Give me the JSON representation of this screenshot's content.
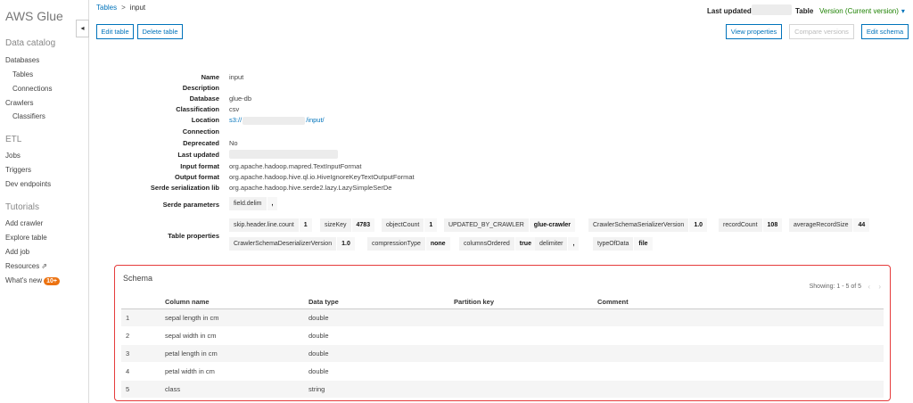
{
  "sidebar": {
    "brand": "AWS Glue",
    "data_catalog": {
      "title": "Data catalog",
      "items": [
        "Databases",
        "Tables",
        "Connections",
        "Crawlers",
        "Classifiers"
      ]
    },
    "etl": {
      "title": "ETL",
      "items": [
        "Jobs",
        "Triggers",
        "Dev endpoints"
      ]
    },
    "tutorials": {
      "title": "Tutorials",
      "items": [
        "Add crawler",
        "Explore table",
        "Add job"
      ]
    },
    "resources": "Resources",
    "whats_new": "What's new",
    "whats_new_badge": "10+",
    "collapse_glyph": "◂",
    "external_glyph": "⇗"
  },
  "breadcrumb": {
    "tables": "Tables",
    "separator": ">",
    "current": "input"
  },
  "header": {
    "last_updated_label": "Last updated",
    "table_label": "Table",
    "version": "Version (Current version)",
    "version_caret": "▾"
  },
  "actions": {
    "edit_table": "Edit table",
    "delete_table": "Delete table",
    "view_properties": "View properties",
    "compare_versions": "Compare versions",
    "edit_schema": "Edit schema"
  },
  "properties": {
    "name_label": "Name",
    "name": "input",
    "description_label": "Description",
    "database_label": "Database",
    "database": "glue-db",
    "classification_label": "Classification",
    "classification": "csv",
    "location_label": "Location",
    "location_prefix": "s3://",
    "location_suffix": "/input/",
    "connection_label": "Connection",
    "deprecated_label": "Deprecated",
    "deprecated": "No",
    "last_updated_label": "Last updated",
    "input_format_label": "Input format",
    "input_format": "org.apache.hadoop.mapred.TextInputFormat",
    "output_format_label": "Output format",
    "output_format": "org.apache.hadoop.hive.ql.io.HiveIgnoreKeyTextOutputFormat",
    "serde_lib_label": "Serde serialization lib",
    "serde_lib": "org.apache.hadoop.hive.serde2.lazy.LazySimpleSerDe",
    "serde_params_label": "Serde parameters",
    "serde_params": [
      {
        "key": "field.delim",
        "value": ","
      }
    ],
    "table_props_label": "Table properties",
    "table_props_row1": [
      {
        "key": "skip.header.line.count",
        "value": "1"
      },
      {
        "key": "sizeKey",
        "value": "4783"
      },
      {
        "key": "objectCount",
        "value": "1"
      },
      {
        "key": "UPDATED_BY_CRAWLER",
        "value": "glue-crawler"
      },
      {
        "key": "CrawlerSchemaSerializerVersion",
        "value": "1.0"
      },
      {
        "key": "recordCount",
        "value": "108"
      },
      {
        "key": "averageRecordSize",
        "value": "44"
      }
    ],
    "table_props_row2": [
      {
        "key": "CrawlerSchemaDeserializerVersion",
        "value": "1.0"
      },
      {
        "key": "compressionType",
        "value": "none"
      },
      {
        "key": "columnsOrdered",
        "value": "true"
      },
      {
        "key": "delimiter",
        "value": ","
      },
      {
        "key": "typeOfData",
        "value": "file"
      }
    ]
  },
  "schema": {
    "title": "Schema",
    "showing": "Showing: 1 - 5 of 5",
    "prev": "‹",
    "next": "›",
    "columns": [
      "Column name",
      "Data type",
      "Partition key",
      "Comment"
    ],
    "rows": [
      {
        "num": "1",
        "name": "sepal length in cm",
        "type": "double",
        "partition": "",
        "comment": ""
      },
      {
        "num": "2",
        "name": "sepal width in cm",
        "type": "double",
        "partition": "",
        "comment": ""
      },
      {
        "num": "3",
        "name": "petal length in cm",
        "type": "double",
        "partition": "",
        "comment": ""
      },
      {
        "num": "4",
        "name": "petal width in cm",
        "type": "double",
        "partition": "",
        "comment": ""
      },
      {
        "num": "5",
        "name": "class",
        "type": "string",
        "partition": "",
        "comment": ""
      }
    ]
  },
  "colors": {
    "link": "#0073bb",
    "version": "#1d8102",
    "badge": "#ec7211",
    "highlight_border": "#e53b3b"
  }
}
